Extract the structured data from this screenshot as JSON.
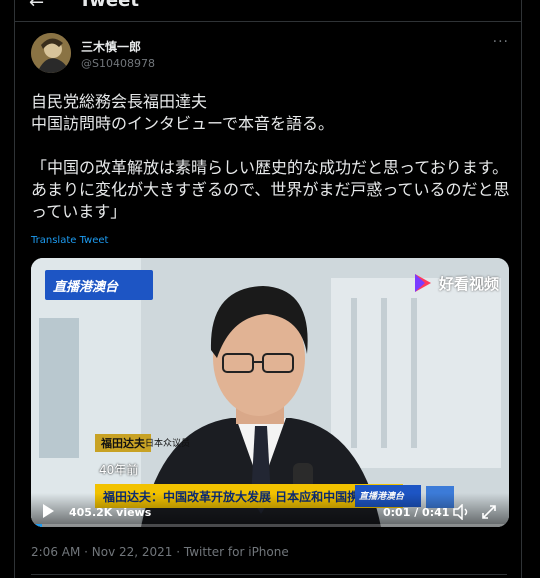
{
  "header": {
    "title": "Tweet"
  },
  "author": {
    "name": "三木慎一郎",
    "handle": "@S10408978"
  },
  "tweet": {
    "text": "自民党総務会長福田達夫\n中国訪問時のインタビューで本音を語る。\n\n「中国の改革解放は素晴らしい歴史的な成功だと思っております。あまりに変化が大きすぎるので、世界がまだ戸惑っているのだと思っています」",
    "translate_label": "Translate Tweet",
    "meta": "2:06 AM · Nov 22, 2021 · Twitter for iPhone"
  },
  "video": {
    "views": "405.2K views",
    "time": "0:01 / 0:41",
    "progress_fraction": 0.024,
    "overlay": {
      "logo_left": "直播港澳台",
      "logo_right": "好看视频",
      "caption_name": "福田达夫",
      "caption_role": "日本众议员",
      "years_text": "40年前",
      "headline": "福田达夫：中国改革开放大发展 日本应和中国携手并进",
      "live_small": "直播港澳台"
    }
  },
  "colors": {
    "accent": "#1d9bf0",
    "background": "#000000",
    "muted": "#71767b"
  }
}
